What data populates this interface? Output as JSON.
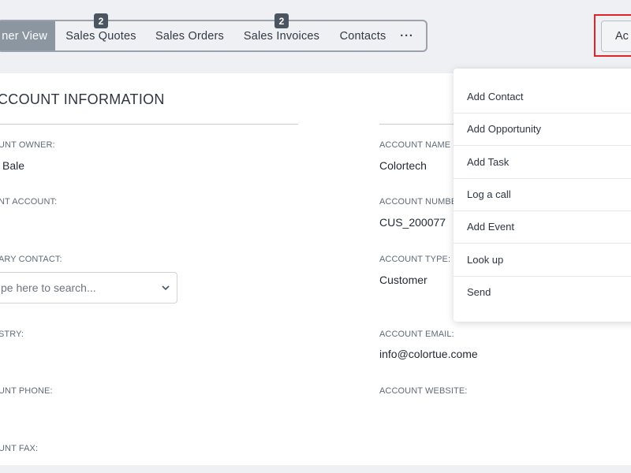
{
  "tabs": [
    {
      "label": "ner View",
      "badge": ""
    },
    {
      "label": "Sales Quotes",
      "badge": "2"
    },
    {
      "label": "Sales Orders",
      "badge": ""
    },
    {
      "label": "Sales Invoices",
      "badge": "2"
    },
    {
      "label": "Contacts",
      "badge": ""
    },
    {
      "label": "···",
      "badge": ""
    }
  ],
  "action_button": {
    "label": "Ac"
  },
  "section": {
    "title": "CCOUNT INFORMATION"
  },
  "fields": {
    "account_owner": {
      "label": "UNT OWNER:",
      "value": "Bale"
    },
    "parent_account": {
      "label": "NT ACCOUNT:",
      "value": ""
    },
    "primary_contact": {
      "label": "ARY CONTACT:",
      "placeholder": "pe here to search..."
    },
    "industry": {
      "label": "STRY:",
      "value": ""
    },
    "account_phone": {
      "label": "UNT PHONE:",
      "value": ""
    },
    "account_fax": {
      "label": "UNT FAX:",
      "value": ""
    },
    "account_name": {
      "label": "ACCOUNT NAME",
      "value": "Colortech"
    },
    "account_number": {
      "label": "ACCOUNT NUMBE",
      "value": "CUS_200077"
    },
    "account_type": {
      "label": "ACCOUNT TYPE:",
      "value": "Customer"
    },
    "account_email": {
      "label": "ACCOUNT EMAIL:",
      "value": "info@colortue.come"
    },
    "account_website": {
      "label": "ACCOUNT WEBSITE:",
      "value": ""
    }
  },
  "menu": {
    "items": [
      "Add Contact",
      "Add Opportunity",
      "Add Task",
      "Log a call",
      "Add Event",
      "Look up",
      "Send"
    ]
  },
  "colors": {
    "highlight_outline": "#e0242a",
    "active_tab": "#8b96a1",
    "badge": "#4b5561"
  }
}
